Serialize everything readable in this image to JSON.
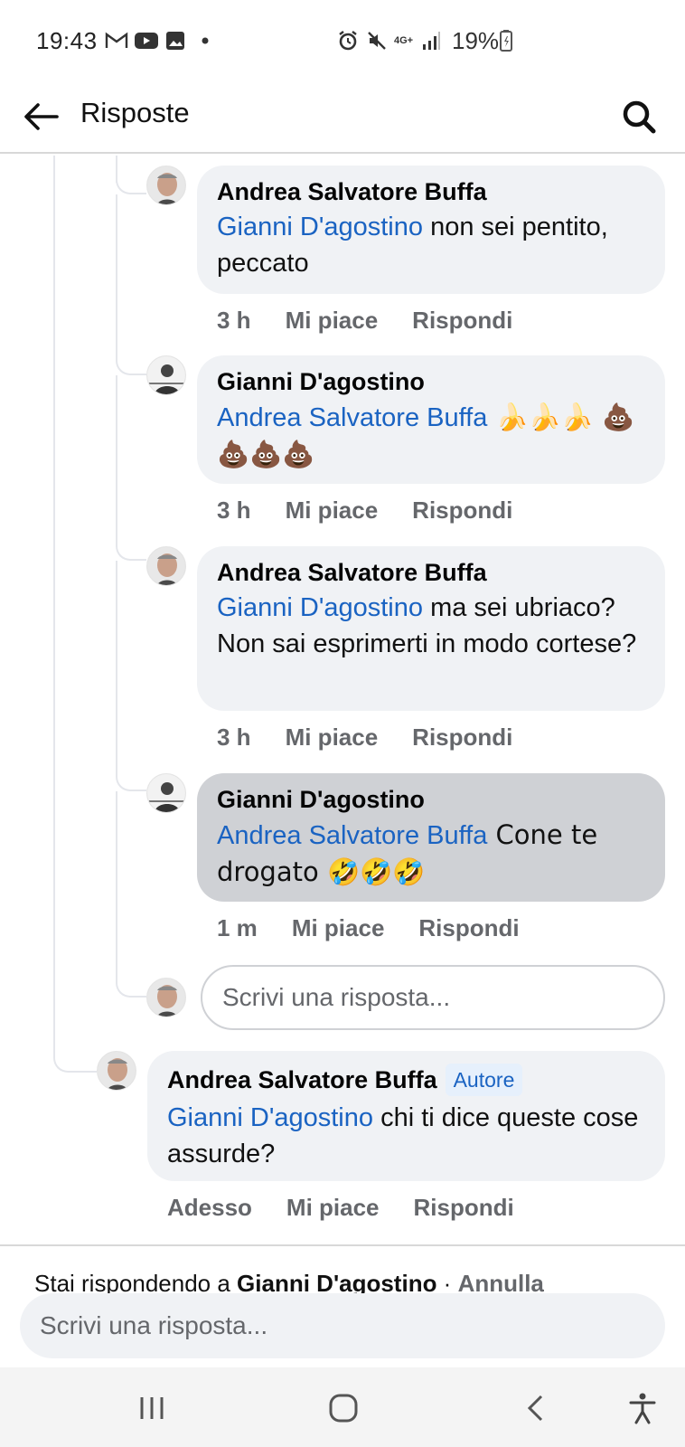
{
  "status_bar": {
    "time": "19:43",
    "battery_percent": "19%",
    "network": "4G+"
  },
  "header": {
    "title": "Risposte"
  },
  "comments": [
    {
      "author": "Andrea Salvatore Buffa",
      "mention": "Gianni D'agostino",
      "text": " non sei pentito, peccato",
      "time": "3 h",
      "like_label": "Mi piace",
      "reply_label": "Rispondi"
    },
    {
      "author": "Gianni D'agostino",
      "mention": "Andrea Salvatore Buffa",
      "text": "  🍌🍌🍌 💩💩💩💩",
      "time": "3 h",
      "like_label": "Mi piace",
      "reply_label": "Rispondi"
    },
    {
      "author": "Andrea Salvatore Buffa",
      "mention": "Gianni D'agostino",
      "text": " ma sei ubriaco? Non sai esprimerti in modo cortese?",
      "time": "3 h",
      "like_label": "Mi piace",
      "reply_label": "Rispondi"
    },
    {
      "author": "Gianni D'agostino",
      "mention": "Andrea Salvatore Buffa",
      "text": " Cone te drogato 🤣🤣🤣",
      "time": "1 m",
      "like_label": "Mi piace",
      "reply_label": "Rispondi"
    },
    {
      "author": "Andrea Salvatore Buffa",
      "badge": "Autore",
      "mention": "Gianni D'agostino",
      "text": " chi ti dice queste cose assurde?",
      "time": "Adesso",
      "like_label": "Mi piace",
      "reply_label": "Rispondi"
    }
  ],
  "inline_reply": {
    "placeholder": "Scrivi una risposta..."
  },
  "composer": {
    "replying_prefix": "Stai rispondendo a ",
    "replying_to": "Gianni D'agostino",
    "separator": " · ",
    "cancel_label": "Annulla",
    "placeholder": "Scrivi una risposta..."
  },
  "icons": {
    "back": "arrow-left-icon",
    "search": "search-icon",
    "nav_recents": "recents-icon",
    "nav_home": "home-icon",
    "nav_back": "back-chevron-icon",
    "nav_accessibility": "accessibility-icon"
  },
  "colors": {
    "mention": "#1a63c2",
    "bubble": "#f0f2f5",
    "bubble_highlight": "#cfd1d5",
    "secondary_text": "#65676b"
  }
}
